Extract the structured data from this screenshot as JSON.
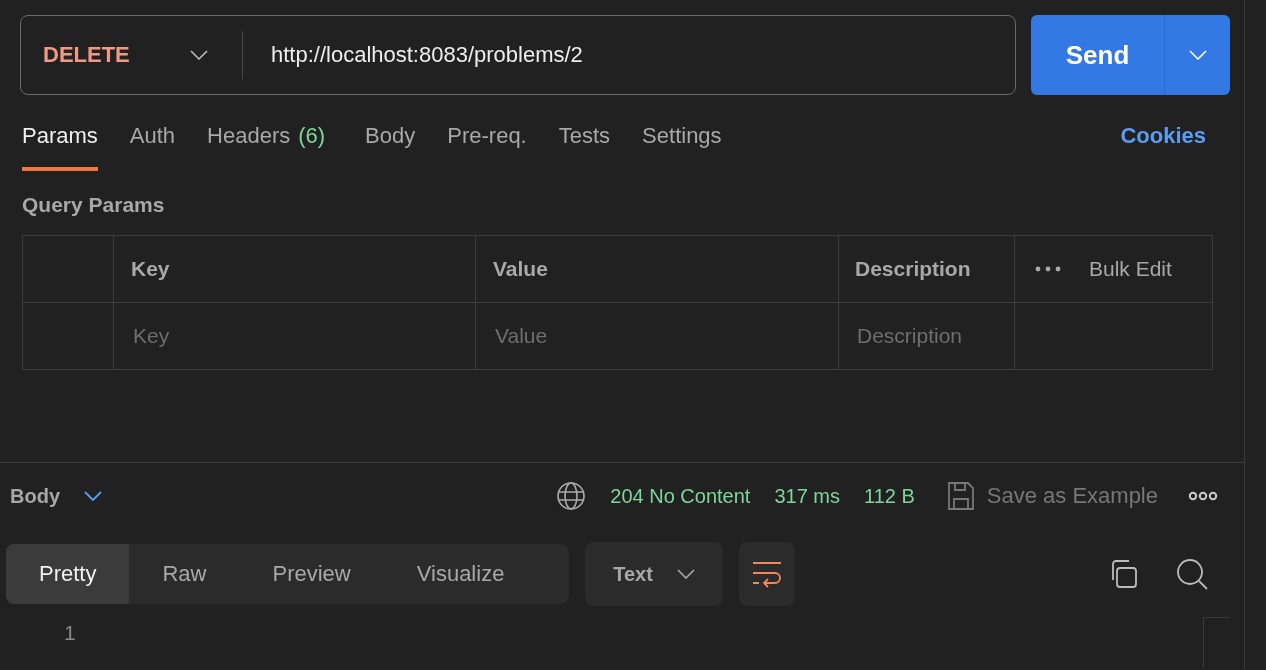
{
  "request": {
    "method": "DELETE",
    "url": "http://localhost:8083/problems/2",
    "send_label": "Send"
  },
  "tabs": [
    {
      "label": "Params",
      "selected": true
    },
    {
      "label": "Auth",
      "selected": false
    },
    {
      "label": "Headers",
      "count": "(6)",
      "selected": false
    },
    {
      "label": "Body",
      "selected": false
    },
    {
      "label": "Pre-req.",
      "selected": false
    },
    {
      "label": "Tests",
      "selected": false
    },
    {
      "label": "Settings",
      "selected": false
    }
  ],
  "cookies_link": "Cookies",
  "query_params": {
    "title": "Query Params",
    "columns": [
      "Key",
      "Value",
      "Description"
    ],
    "bulk_edit": "Bulk Edit",
    "placeholders": [
      "Key",
      "Value",
      "Description"
    ]
  },
  "response": {
    "section_label": "Body",
    "status": "204 No Content",
    "time": "317 ms",
    "size": "112 B",
    "save_label": "Save as Example",
    "view_tabs": [
      {
        "label": "Pretty",
        "selected": true
      },
      {
        "label": "Raw",
        "selected": false
      },
      {
        "label": "Preview",
        "selected": false
      },
      {
        "label": "Visualize",
        "selected": false
      }
    ],
    "format": "Text",
    "wrap_on": true,
    "line_numbers": [
      "1"
    ]
  }
}
